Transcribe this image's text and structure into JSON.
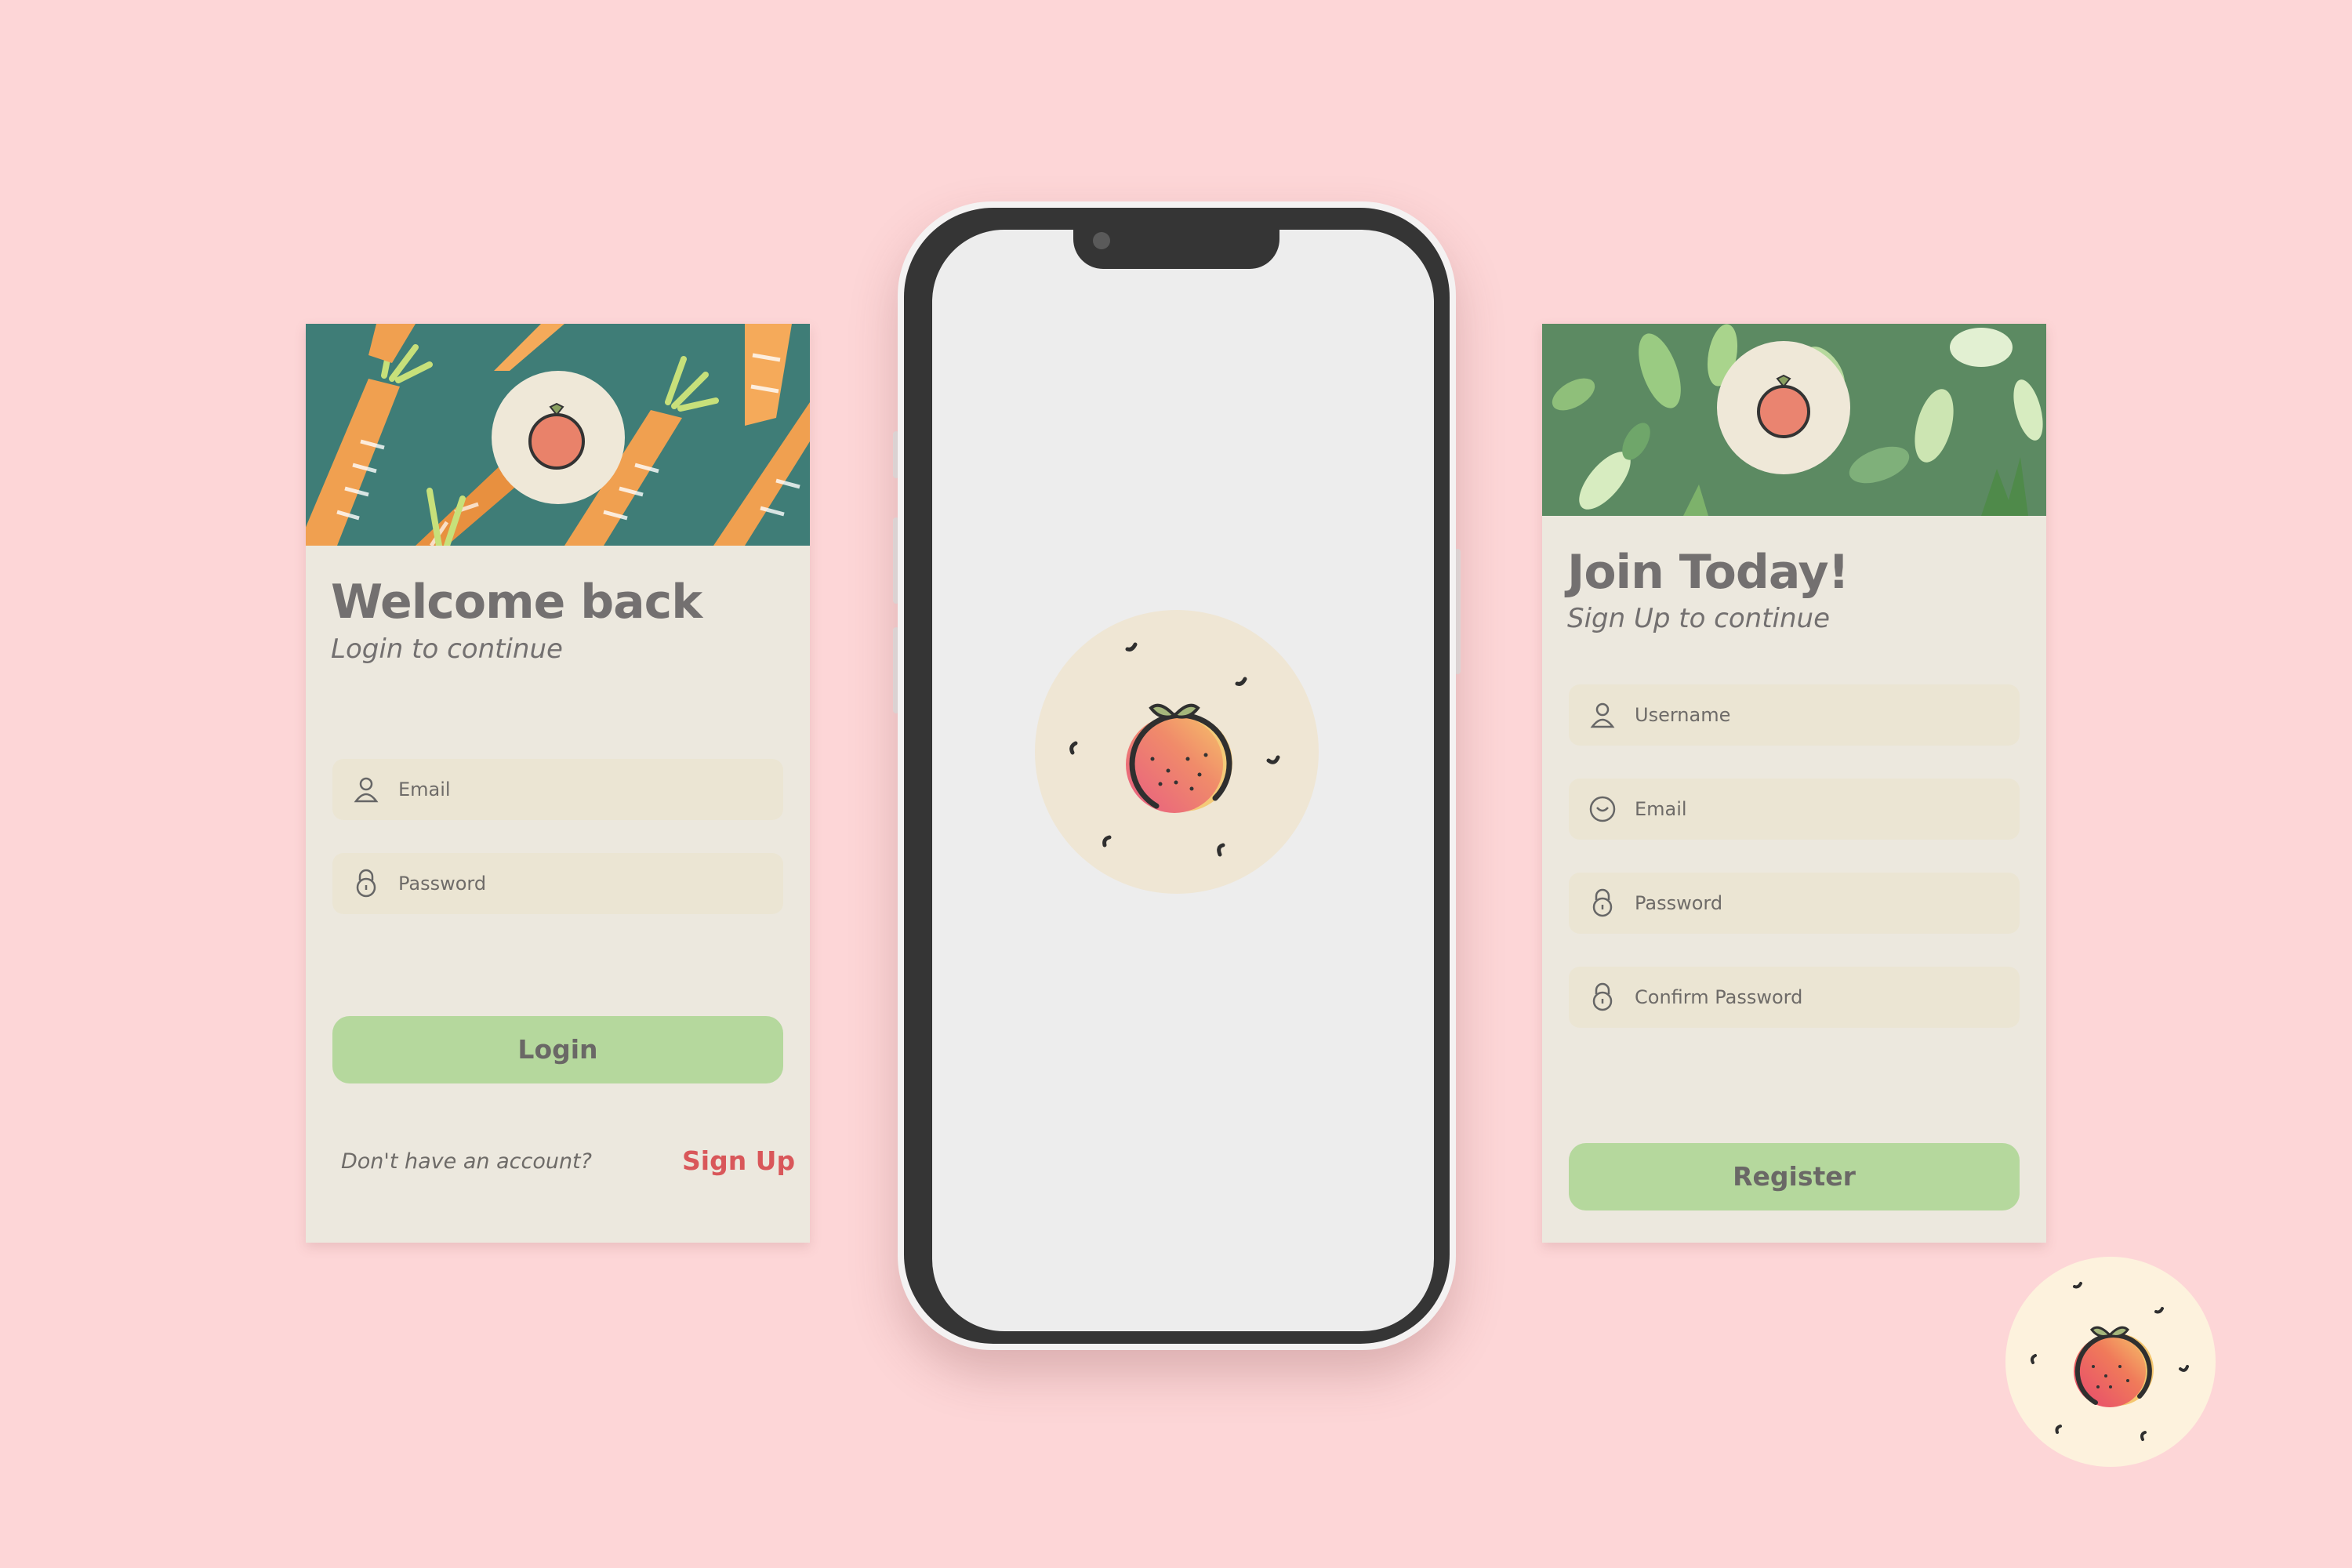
{
  "login": {
    "title": "Welcome back",
    "subtitle": "Login to continue",
    "fields": [
      {
        "placeholder": "Email",
        "icon": "user-icon"
      },
      {
        "placeholder": "Password",
        "icon": "lock-icon"
      }
    ],
    "button": "Login",
    "footer_prompt": "Don't have an account?",
    "footer_link": "Sign Up"
  },
  "signup": {
    "title": "Join Today!",
    "subtitle": "Sign Up to continue",
    "fields": [
      {
        "placeholder": "Username",
        "icon": "user-icon"
      },
      {
        "placeholder": "Email",
        "icon": "smiley-icon"
      },
      {
        "placeholder": "Password",
        "icon": "lock-icon"
      },
      {
        "placeholder": "Confirm Password",
        "icon": "lock-icon"
      }
    ],
    "button": "Register"
  },
  "colors": {
    "background": "#fdd6d7",
    "card": "#ece8de",
    "field": "#ebe5d3",
    "button": "#b5d89d",
    "link": "#d9575a",
    "text": "#737070",
    "phone_bezel": "#353535",
    "phone_screen": "#ededed"
  }
}
